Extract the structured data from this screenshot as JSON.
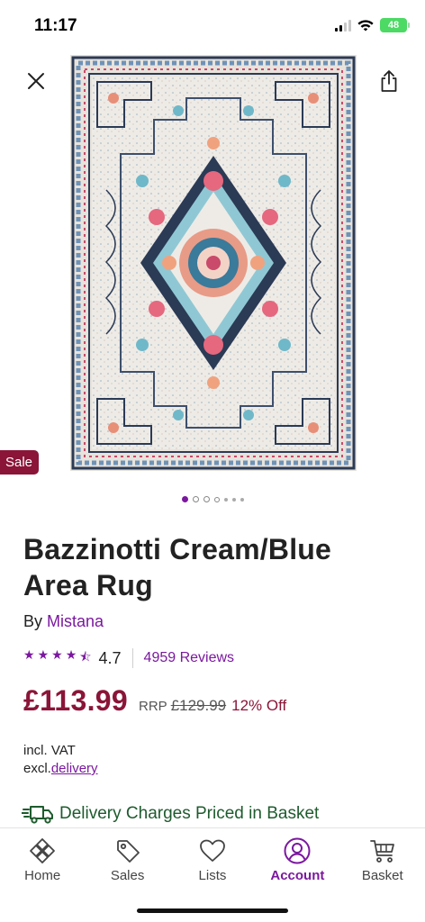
{
  "status_bar": {
    "time": "11:17",
    "battery": "48"
  },
  "hero": {
    "sale_badge": "Sale",
    "carousel_pages": 7,
    "carousel_active": 0
  },
  "product": {
    "title": "Bazzinotti Cream/Blue Area Rug",
    "by_label": "By",
    "brand": "Mistana",
    "rating": "4.7",
    "rating_stars": 4.5,
    "reviews": "4959 Reviews",
    "price": "£113.99",
    "rrp_label": "RRP",
    "rrp_value": "£129.99",
    "discount": "12% Off",
    "vat_note": "incl. VAT",
    "delivery_prefix": "excl.",
    "delivery_link": "delivery",
    "delivery_banner": "Delivery Charges Priced in Basket"
  },
  "colors": {
    "brand_purple": "#7b189f",
    "sale_red": "#8a1538",
    "delivery_green": "#1e5b2e"
  },
  "nav": {
    "items": [
      {
        "label": "Home",
        "icon": "home-icon",
        "active": false
      },
      {
        "label": "Sales",
        "icon": "tag-icon",
        "active": false
      },
      {
        "label": "Lists",
        "icon": "heart-icon",
        "active": false
      },
      {
        "label": "Account",
        "icon": "account-icon",
        "active": true
      },
      {
        "label": "Basket",
        "icon": "basket-icon",
        "active": false
      }
    ]
  }
}
